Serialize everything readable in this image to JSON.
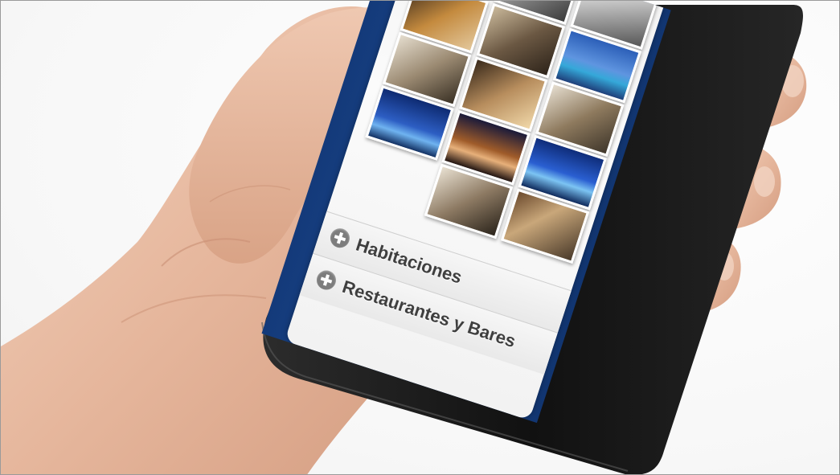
{
  "app": {
    "gallery_icon": "hotel-photo-gallery",
    "photos": [
      {
        "name": "building-exterior-day"
      },
      {
        "name": "building-facade-white"
      },
      {
        "name": "lobby-reception"
      },
      {
        "name": "lounge-interior"
      },
      {
        "name": "rooftop-pool-dusk"
      },
      {
        "name": "bedroom-suite"
      },
      {
        "name": "bathroom-interior"
      },
      {
        "name": "restaurant-dining"
      },
      {
        "name": "bar-lounge"
      },
      {
        "name": "terrace-night"
      },
      {
        "name": "hotel-tower-night"
      },
      {
        "name": "pool-night"
      },
      {
        "name": "entrance-sign"
      }
    ],
    "menu": [
      {
        "label": "Habitaciones",
        "icon": "plus-circle-icon"
      },
      {
        "label": "Restaurantes y Bares",
        "icon": "plus-circle-icon"
      }
    ]
  },
  "colors": {
    "screen_blue": "#1c4c92",
    "panel_bg": "#f4f4f4",
    "menu_text": "#3f3f3f",
    "phone_body": "#1a1a1a",
    "skin": "#e8bfa8"
  }
}
